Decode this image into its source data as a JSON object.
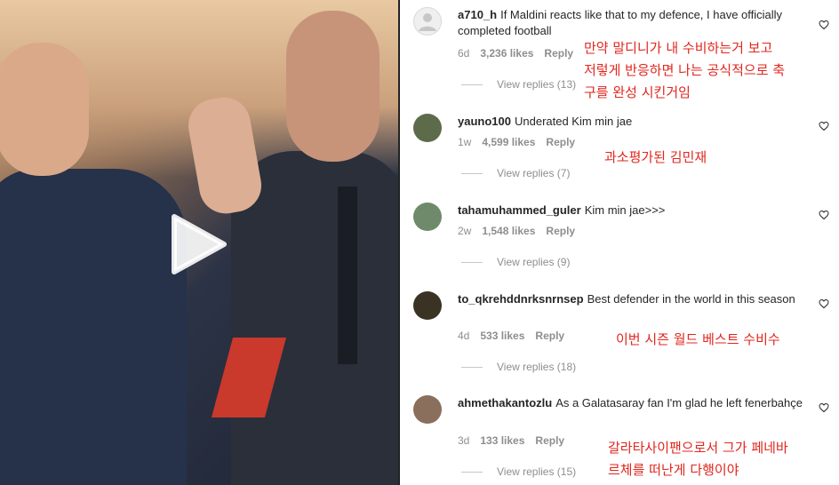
{
  "video": {
    "play_icon": "play-icon"
  },
  "comments": [
    {
      "username": "a710_h",
      "text": "If Maldini reacts like that to my defence, I have officially completed football",
      "time": "6d",
      "likes": "3,236 likes",
      "reply": "Reply",
      "view_replies": "View replies (13)",
      "translation": [
        "만약 말디니가 내 수비하는거 보고",
        "저렇게 반응하면 나는 공식적으로 축",
        "구를 완성 시킨거임"
      ],
      "avatar_color": "#dbdbdb"
    },
    {
      "username": "yauno100",
      "text": "Underated Kim min jae",
      "time": "1w",
      "likes": "4,599 likes",
      "reply": "Reply",
      "view_replies": "View replies (7)",
      "translation": [
        "과소평가된 김민재"
      ],
      "avatar_color": "#5c6b4a"
    },
    {
      "username": "tahamuhammed_guler",
      "text": "Kim min jae>>>",
      "time": "2w",
      "likes": "1,548 likes",
      "reply": "Reply",
      "view_replies": "View replies (9)",
      "translation": [],
      "avatar_color": "#6f8a6a"
    },
    {
      "username": "to_qkrehddnrksnrnsep",
      "text": "Best defender in the world in this season",
      "time": "4d",
      "likes": "533 likes",
      "reply": "Reply",
      "view_replies": "View replies (18)",
      "translation": [
        "이번 시즌 월드 베스트 수비수"
      ],
      "avatar_color": "#3a3324"
    },
    {
      "username": "ahmethakantozlu",
      "text": "As a Galatasaray fan I'm glad he left fenerbahçe",
      "time": "3d",
      "likes": "133 likes",
      "reply": "Reply",
      "view_replies": "View replies (15)",
      "translation": [
        "갈라타사이팬으로서 그가 페네바",
        "르체를 떠난게 다행이야"
      ],
      "avatar_color": "#8a6f5c"
    }
  ],
  "colors": {
    "translation": "#e0261e",
    "muted": "#8e8e8e"
  }
}
